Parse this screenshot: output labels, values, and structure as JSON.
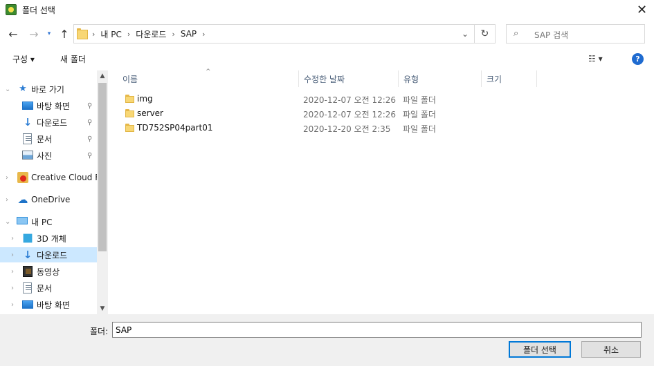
{
  "window": {
    "title": "폴더 선택",
    "close_glyph": "✕"
  },
  "nav": {
    "back_glyph": "←",
    "forward_glyph": "→",
    "recent_glyph": "▾",
    "up_glyph": "↑",
    "breadcrumbs": [
      "내 PC",
      "다운로드",
      "SAP"
    ],
    "sep_glyph": "›",
    "dropdown_glyph": "⌄",
    "refresh_glyph": "↻"
  },
  "search": {
    "placeholder": "SAP 검색",
    "icon_glyph": "⌕"
  },
  "toolbar": {
    "organize_label": "구성 ▾",
    "new_folder_label": "새 폴더",
    "view_label": "☷ ▾",
    "help_label": "?"
  },
  "sidebar": {
    "items": [
      {
        "label": "바로 가기",
        "icon": "star-icon",
        "level": 0,
        "expanded": true
      },
      {
        "label": "바탕 화면",
        "icon": "desktop-icon",
        "level": 1,
        "pinned": true
      },
      {
        "label": "다운로드",
        "icon": "download-icon",
        "level": 1,
        "pinned": true
      },
      {
        "label": "문서",
        "icon": "document-icon",
        "level": 1,
        "pinned": true
      },
      {
        "label": "사진",
        "icon": "picture-icon",
        "level": 1,
        "pinned": true
      },
      {
        "label": "Creative Cloud Fil",
        "icon": "creative-cloud-icon",
        "level": 0
      },
      {
        "label": "OneDrive",
        "icon": "onedrive-icon",
        "level": 0
      },
      {
        "label": "내 PC",
        "icon": "pc-icon",
        "level": 0,
        "expanded": true
      },
      {
        "label": "3D 개체",
        "icon": "3d-objects-icon",
        "level": 1
      },
      {
        "label": "다운로드",
        "icon": "download-icon",
        "level": 1,
        "selected": true
      },
      {
        "label": "동영상",
        "icon": "video-icon",
        "level": 1
      },
      {
        "label": "문서",
        "icon": "document-icon",
        "level": 1
      },
      {
        "label": "바탕 화면",
        "icon": "desktop-icon",
        "level": 1
      }
    ],
    "pin_glyph": "📌",
    "chevron_glyph": "›",
    "expanded_glyph": "⌄"
  },
  "filelist": {
    "columns": [
      "이름",
      "수정한 날짜",
      "유형",
      "크기"
    ],
    "sort_glyph": "^",
    "rows": [
      {
        "name": "img",
        "modified": "2020-12-07 오전 12:26",
        "type": "파일 폴더"
      },
      {
        "name": "server",
        "modified": "2020-12-07 오전 12:26",
        "type": "파일 폴더"
      },
      {
        "name": "TD752SP04part01",
        "modified": "2020-12-20 오전 2:35",
        "type": "파일 폴더"
      }
    ]
  },
  "bottom": {
    "folder_label": "폴더:",
    "folder_value": "SAP",
    "select_label": "폴더 선택",
    "cancel_label": "취소"
  },
  "colors": {
    "accent": "#0078d7",
    "selected_bg": "#cce8ff",
    "folder": "#f8d775"
  }
}
